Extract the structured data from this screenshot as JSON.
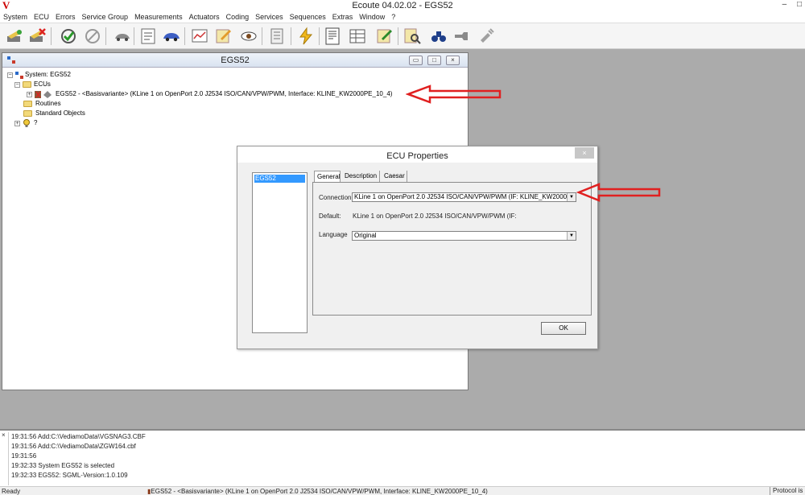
{
  "app": {
    "logo": "V",
    "title": "Ecoute 04.02.02 - EGS52",
    "window_controls": [
      "–",
      "□"
    ]
  },
  "menu": [
    "System",
    "ECU",
    "Errors",
    "Service Group",
    "Measurements",
    "Actuators",
    "Coding",
    "Services",
    "Sequences",
    "Extras",
    "Window",
    "?"
  ],
  "toolbar_icons": [
    "connect-icon",
    "disconnect-icon",
    "check-icon",
    "cancel-check-icon",
    "car-gray-icon",
    "document-icon",
    "car-blue-icon",
    "chart-icon",
    "edit-icon",
    "eye-icon",
    "list-icon",
    "flash-icon",
    "page-icon",
    "table-icon",
    "code-edit-icon",
    "search-doc-icon",
    "binoculars-icon",
    "plug-icon",
    "plug-gray-icon"
  ],
  "child_window": {
    "title": "EGS52",
    "tree": {
      "root": "System: EGS52",
      "ecus": "ECUs",
      "ecu_entry": "EGS52 - <Basisvariante> (KLine 1 on OpenPort 2.0 J2534 ISO/CAN/VPW/PWM, Interface: KLINE_KW2000PE_10_4)",
      "routines": "Routines",
      "standard_objects": "Standard Objects",
      "unknown": "?"
    }
  },
  "dialog": {
    "title": "ECU Properties",
    "close": "×",
    "list_items": [
      "EGS52"
    ],
    "tabs": [
      "General",
      "Description",
      "Caesar"
    ],
    "connection_label": "Connection",
    "connection_value": "KLine 1 on OpenPort 2.0 J2534 ISO/CAN/VPW/PWM (IF: KLINE_KW2000P",
    "default_label": "Default:",
    "default_value": "KLine 1 on OpenPort 2.0 J2534 ISO/CAN/VPW/PWM (IF:",
    "language_label": "Language",
    "language_value": "Original",
    "ok_label": "OK"
  },
  "log": {
    "close": "×",
    "lines": [
      "19:31:56 Add:C:\\VediamoData\\VGSNAG3.CBF",
      "19:31:56 Add:C:\\VediamoData\\ZGW164.cbf",
      "19:31:56",
      "19:32:33 System EGS52 is selected",
      "19:32:33 EGS52: SGML-Version:1.0.109"
    ]
  },
  "status": {
    "ready": "Ready",
    "ecu": "EGS52 - <Basisvariante> (KLine 1 on OpenPort 2.0 J2534 ISO/CAN/VPW/PWM, Interface: KLINE_KW2000PE_10_4)",
    "protocol": "Protocol is"
  },
  "colors": {
    "arrow": "#e02020",
    "selection": "#3399ff",
    "mdi_background": "#ababab"
  }
}
